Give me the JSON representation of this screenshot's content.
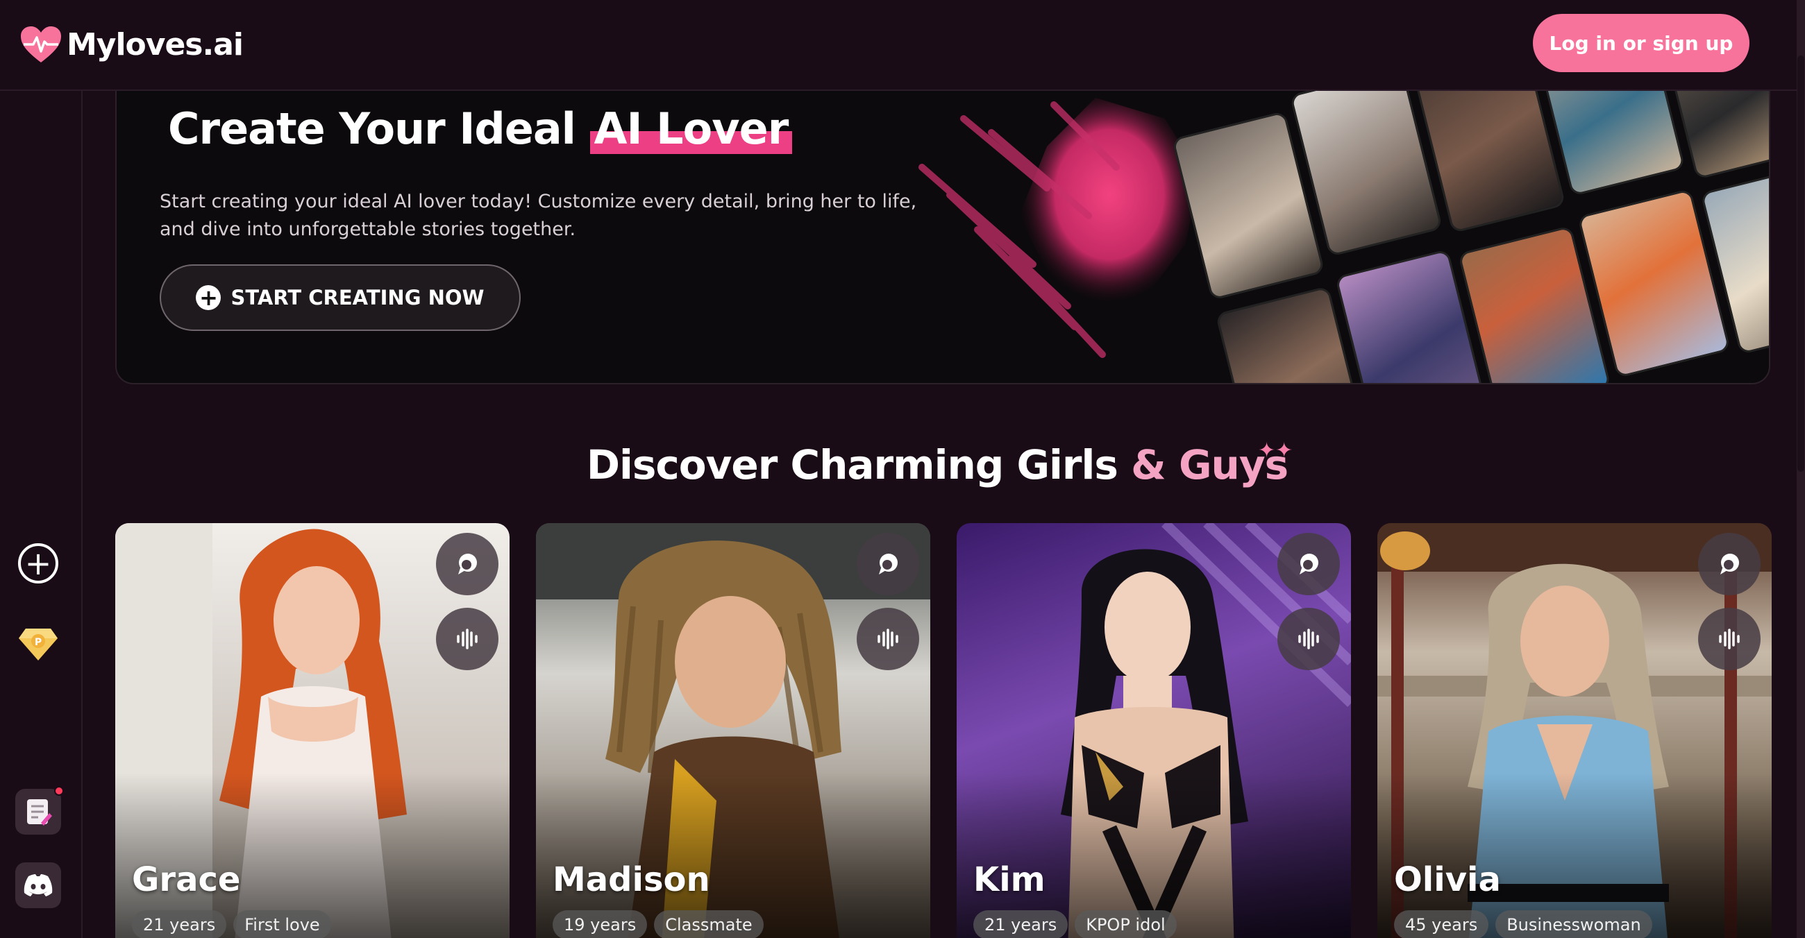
{
  "header": {
    "logo_text": "Myloves.ai",
    "login_label": "Log in or sign up"
  },
  "sidebar": {
    "items": [
      {
        "name": "create",
        "icon": "plus-circle-icon"
      },
      {
        "name": "premium",
        "icon": "gem-icon"
      },
      {
        "name": "notes",
        "icon": "notes-icon",
        "has_notification": true
      },
      {
        "name": "discord",
        "icon": "discord-icon"
      }
    ]
  },
  "banner": {
    "title_prefix": "Create Your Ideal",
    "title_highlight": "AI Lover",
    "description": "Start creating your ideal AI lover today! Customize every detail, bring her to life, and dive into unforgettable stories together.",
    "cta_label": "START CREATING NOW"
  },
  "section": {
    "title_part1": "Discover Charming Girls",
    "title_amp": "&",
    "title_part2": "Guys"
  },
  "cards": [
    {
      "name": "Grace",
      "age": "21 years",
      "role": "First love"
    },
    {
      "name": "Madison",
      "age": "19 years",
      "role": "Classmate"
    },
    {
      "name": "Kim",
      "age": "21 years",
      "role": "KPOP idol"
    },
    {
      "name": "Olivia",
      "age": "45 years",
      "role": "Businesswoman"
    }
  ],
  "colors": {
    "background": "#1a0c17",
    "accent_pink": "#f8739c",
    "highlight_pink": "#ec3f84",
    "soft_pink": "#f5a3c2"
  }
}
